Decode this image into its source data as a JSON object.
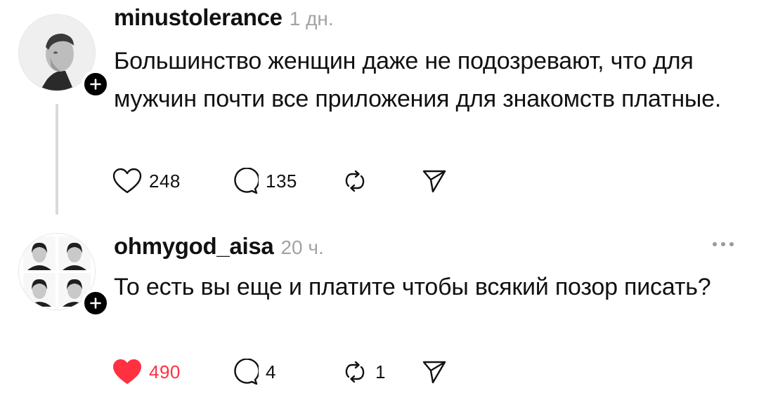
{
  "posts": [
    {
      "username": "minustolerance",
      "timestamp": "1 дн.",
      "text": "Большинство женщин даже не подозревают, что для мужчин почти все приложения для знакомств платные.",
      "likes": "248",
      "comments": "135",
      "reposts": "",
      "liked": false,
      "icons": {
        "like": "heart-outline-icon",
        "comment": "speech-bubble-icon",
        "repost": "repost-arrows-icon",
        "share": "send-paper-plane-icon",
        "follow": "plus-icon"
      }
    },
    {
      "username": "ohmygod_aisa",
      "timestamp": "20 ч.",
      "text": "То есть вы еще и платите чтобы всякий позор писать?",
      "likes": "490",
      "comments": "4",
      "reposts": "1",
      "liked": true,
      "icons": {
        "like": "heart-filled-icon",
        "comment": "speech-bubble-icon",
        "repost": "repost-arrows-icon",
        "share": "send-paper-plane-icon",
        "follow": "plus-icon",
        "more": "more-dots-icon"
      }
    }
  ],
  "colors": {
    "text": "#111111",
    "muted": "#a3a3a3",
    "like_active": "#ff3040",
    "thread_line": "#d9d9d9"
  }
}
